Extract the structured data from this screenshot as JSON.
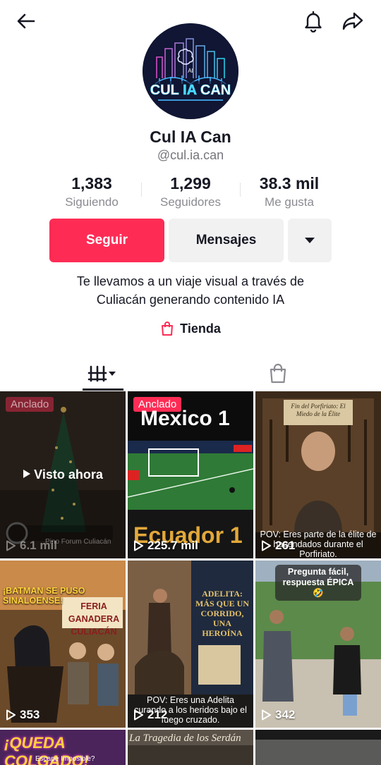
{
  "profile": {
    "display_name": "Cul IA Can",
    "handle": "@cul.ia.can",
    "avatar_text": "CUL IA CAN",
    "bio_line1": "Te llevamos a un viaje visual a través de",
    "bio_line2": "Culiacán generando contenido IA",
    "shop_label": "Tienda"
  },
  "stats": [
    {
      "value": "1,383",
      "label": "Siguiendo"
    },
    {
      "value": "1,299",
      "label": "Seguidores"
    },
    {
      "value": "38.3 mil",
      "label": "Me gusta"
    }
  ],
  "buttons": {
    "follow": "Seguir",
    "message": "Mensajes"
  },
  "colors": {
    "accent": "#fe2c55",
    "secondary_button": "#f1f1f2",
    "muted_text": "#8a8b91"
  },
  "videos": [
    {
      "pinned": "Anclado",
      "overlay": "Visto ahora",
      "watermark": "Pino Forum Culiacán",
      "views": "6.1 mil"
    },
    {
      "pinned": "Anclado",
      "title_top": "Mexico 1",
      "title_bottom": "Ecuador 1",
      "views": "225.7 mil"
    },
    {
      "caption_top": "Fin del Porfiriato: El Miedo de la Élite",
      "caption": "POV: Eres parte de la élite de hacendados durante el Porfiriato.",
      "views": "261"
    },
    {
      "banner": "¡BATMAN SE PUSO SINALOENSE!",
      "sign": "FERIA GANADERA CULIACÁN",
      "views": "353"
    },
    {
      "title": "ADELITA: MÁS QUE UN CORRIDO, UNA HEROÍNA",
      "caption": "POV: Eres una Adelita curando a los heridos bajo el fuego cruzado.",
      "views": "212"
    },
    {
      "bubble": "Pregunta fácil, respuesta ÉPICA 🤣",
      "views": "342"
    },
    {
      "title": "¡QUEDA COLGADO!",
      "subtitle": "Escape Imposible?"
    },
    {
      "title": "La Tragedia de los Serdán"
    },
    {}
  ]
}
